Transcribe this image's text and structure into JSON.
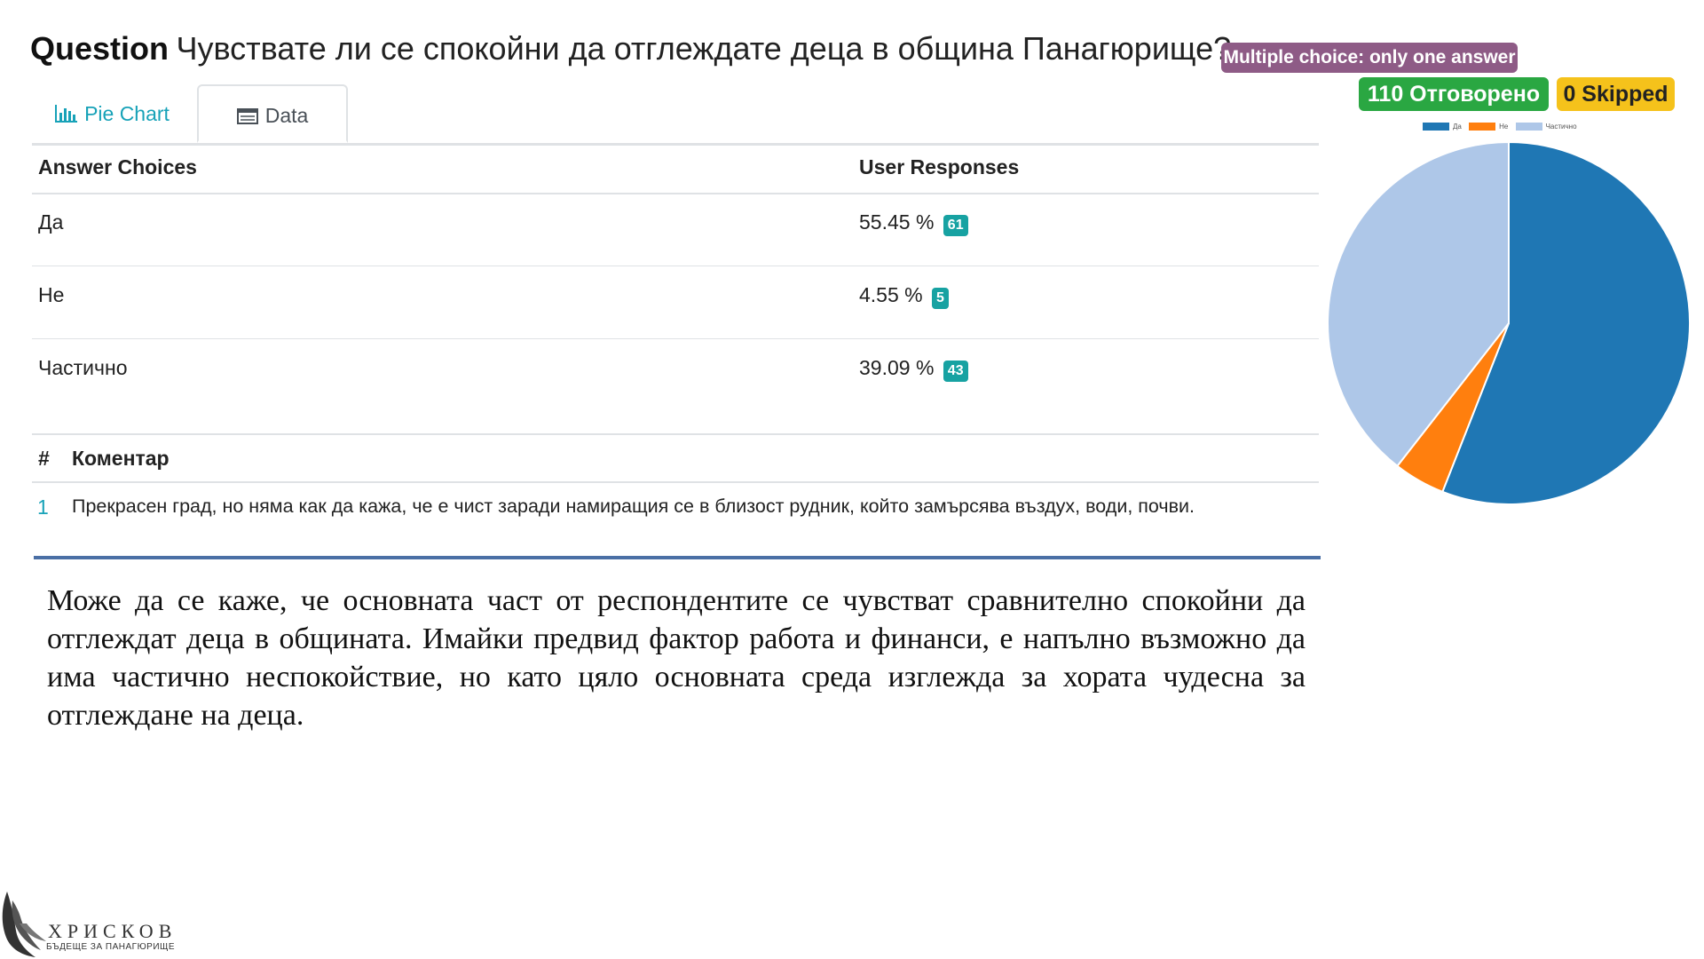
{
  "question": {
    "label": "Question",
    "text": "Чувствате ли се спокойни да отглеждате деца в община Панагюрище?",
    "type_badge": "Multiple choice: only one answer",
    "answered_badge": "110 Отговорено",
    "skipped_badge": "0 Skipped"
  },
  "tabs": [
    {
      "label": "Pie Chart",
      "icon": "bar-chart-icon",
      "active": false
    },
    {
      "label": "Data",
      "icon": "table-icon",
      "active": true
    }
  ],
  "table": {
    "headers": [
      "Answer Choices",
      "User Responses"
    ],
    "rows": [
      {
        "choice": "Да",
        "percent": "55.45 %",
        "count": "61"
      },
      {
        "choice": "Не",
        "percent": "4.55 %",
        "count": "5"
      },
      {
        "choice": "Частично",
        "percent": "39.09 %",
        "count": "43"
      }
    ]
  },
  "comments": {
    "headers": [
      "#",
      "Коментар"
    ],
    "rows": [
      {
        "num": "1",
        "text": "Прекрасен град, но няма как да кажа, че е чист заради намиращия се в близост рудник, който замърсява въздух, води, почви."
      }
    ]
  },
  "summary": "Може да се каже, че основната част от респондентите се чувстват сравнително спокойни да отглеждат деца в общината. Имайки предвид фактор работа и финанси, е напълно възможно да има частично неспокойствие, но като цяло основната среда изглежда за хората чудесна за отглеждане на деца.",
  "logo": {
    "name": "ХРИСКОВ",
    "subtitle": "БЪДЕЩЕ ЗА ПАНАГЮРИЩЕ"
  },
  "colors": {
    "accent": "#17a2b8",
    "answered": "#2aa742",
    "skipped": "#f5c21b",
    "type": "#8e5b86"
  },
  "chart_data": {
    "type": "pie",
    "categories": [
      "Да",
      "Не",
      "Частично"
    ],
    "values": [
      61,
      5,
      43
    ],
    "colors": [
      "#1f77b4",
      "#ff7f0e",
      "#aec7e8"
    ],
    "legend": "top"
  }
}
